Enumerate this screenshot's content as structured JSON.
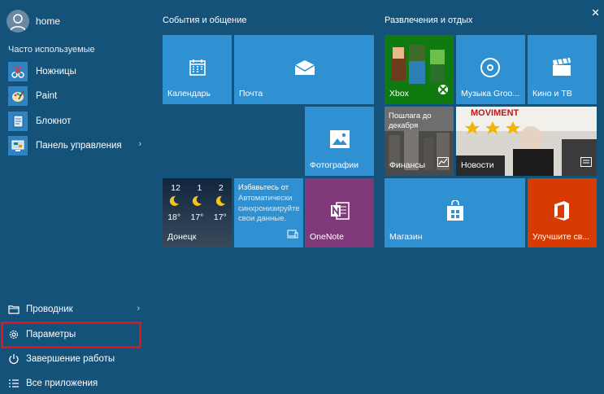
{
  "user": {
    "name": "home"
  },
  "frequent": {
    "label": "Часто используемые",
    "items": [
      {
        "label": "Ножницы",
        "icon": "scissors-icon"
      },
      {
        "label": "Paint",
        "icon": "paint-palette-icon"
      },
      {
        "label": "Блокнот",
        "icon": "notepad-icon"
      },
      {
        "label": "Панель управления",
        "icon": "control-panel-icon",
        "has_arrow": true
      }
    ]
  },
  "bottom_items": [
    {
      "label": "Проводник",
      "icon": "folder-icon",
      "has_arrow": true
    },
    {
      "label": "Параметры",
      "icon": "gear-icon",
      "highlighted": true
    },
    {
      "label": "Завершение работы",
      "icon": "power-icon"
    },
    {
      "label": "Все приложения",
      "icon": "list-icon"
    }
  ],
  "groups": {
    "life": "События и общение",
    "play": "Развлечения и отдых"
  },
  "tiles": {
    "calendar": "Календарь",
    "mail": "Почта",
    "photos": "Фотографии",
    "weather": {
      "city": "Донецк",
      "times": [
        "12",
        "1",
        "2"
      ],
      "temps": [
        "18°",
        "17°",
        "17°"
      ]
    },
    "reminder": {
      "title": "Избавьтесь от",
      "lines": "Автоматически синхронизируйте свои данные."
    },
    "onenote": "OneNote",
    "xbox": "Xbox",
    "music": "Музыка Groo...",
    "movies": "Кино и ТВ",
    "finance": {
      "headline": "Пошлага до декабря",
      "label": "Финансы"
    },
    "news": {
      "label": "Новости",
      "sign": "MOVIMENT"
    },
    "store": "Магазин",
    "office": "Улучшите св..."
  },
  "colors": {
    "background": "#14527a",
    "tile": "#2f90d2",
    "onenote": "#80397b",
    "office": "#d83b01",
    "xbox": "#107c10",
    "highlight": "#e0141e"
  }
}
